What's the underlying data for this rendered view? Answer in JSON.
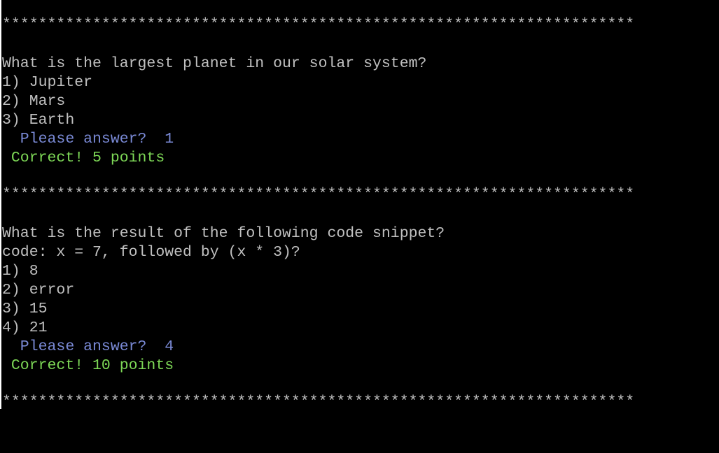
{
  "separator": "**********************************************************************",
  "q1": {
    "question": "What is the largest planet in our solar system?",
    "options": [
      "1) Jupiter",
      "2) Mars",
      "3) Earth"
    ],
    "prompt": "  Please answer?  1",
    "result": " Correct! 5 points"
  },
  "q2": {
    "question": "What is the result of the following code snippet?",
    "code": "code: x = 7, followed by (x * 3)?",
    "options": [
      "1) 8",
      "2) error",
      "3) 15",
      "4) 21"
    ],
    "prompt": "  Please answer?  4",
    "result": " Correct! 10 points"
  },
  "colors": {
    "background": "#000000",
    "text": "#c0c0c0",
    "prompt": "#7a8ad6",
    "correct": "#7ed957"
  }
}
